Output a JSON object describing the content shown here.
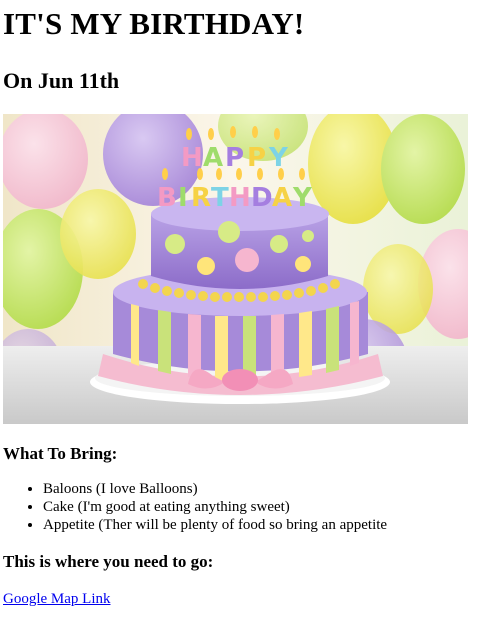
{
  "page": {
    "title": "IT'S MY BIRTHDAY!",
    "date_heading": "On Jun 11th",
    "cake_image": {
      "name": "birthday-cake-photo",
      "candle_letters_line1": "HAPPY",
      "candle_letters_line2": "BIRTHDAY"
    },
    "bring_heading": "What To Bring:",
    "bring_items": [
      "Baloons (I love Balloons)",
      "Cake (I'm good at eating anything sweet)",
      "Appetite (Ther will be plenty of food so bring an appetite"
    ],
    "location_heading": "This is where you need to go:",
    "map_link_text": "Google Map Link"
  }
}
